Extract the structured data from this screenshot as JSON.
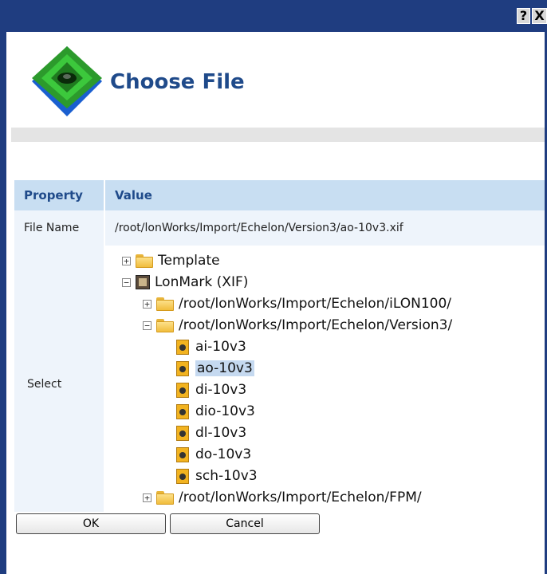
{
  "titlebar": {
    "help_label": "?",
    "close_label": "X",
    "color": "#1f3d80"
  },
  "dialog": {
    "title": "Choose File"
  },
  "table": {
    "headers": {
      "property": "Property",
      "value": "Value"
    },
    "file_name": {
      "label": "File Name",
      "value": "/root/lonWorks/Import/Echelon/Version3/ao-10v3.xif"
    },
    "select": {
      "label": "Select"
    }
  },
  "tree": {
    "template": {
      "label": "Template",
      "expander": "+"
    },
    "lonmark": {
      "label": "LonMark (XIF)",
      "expander": "−"
    },
    "ilon": {
      "label": "/root/lonWorks/Import/Echelon/iLON100/",
      "expander": "+"
    },
    "version3": {
      "label": "/root/lonWorks/Import/Echelon/Version3/",
      "expander": "−"
    },
    "files": [
      "ai-10v3",
      "ao-10v3",
      "di-10v3",
      "dio-10v3",
      "dl-10v3",
      "do-10v3",
      "sch-10v3"
    ],
    "selected_file": "ao-10v3",
    "fpm": {
      "label": "/root/lonWorks/Import/Echelon/FPM/",
      "expander": "+"
    }
  },
  "buttons": {
    "ok": "OK",
    "cancel": "Cancel"
  },
  "icons": [
    "help-icon",
    "close-icon",
    "logo-icon",
    "folder-icon",
    "lonmark-icon",
    "xif-file-icon",
    "expand-icon",
    "collapse-icon"
  ]
}
